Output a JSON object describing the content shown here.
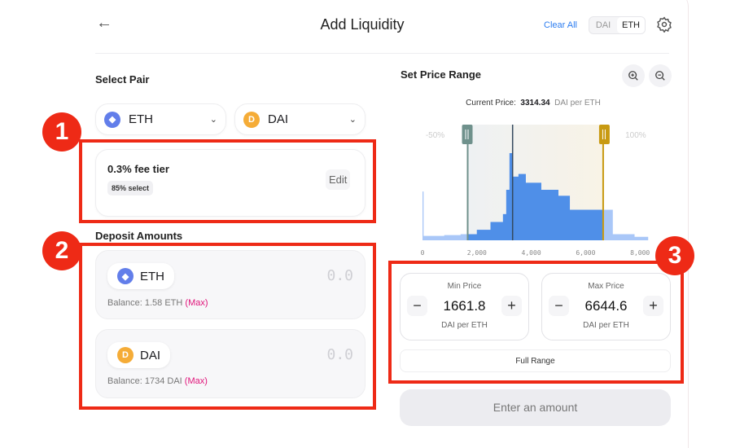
{
  "header": {
    "title": "Add Liquidity",
    "clear_all": "Clear All",
    "toggle": [
      "DAI",
      "ETH"
    ],
    "toggle_selected": "ETH",
    "back_icon": "arrow-left-icon",
    "settings_icon": "gear-icon"
  },
  "select_pair": {
    "label": "Select Pair",
    "token_a": "ETH",
    "token_b": "DAI"
  },
  "fee": {
    "title": "0.3% fee tier",
    "badge": "85% select",
    "edit": "Edit"
  },
  "deposit": {
    "label": "Deposit Amounts",
    "items": [
      {
        "token": "ETH",
        "amount": "0.0",
        "balance": "Balance: 1.58 ETH",
        "max": "(Max)"
      },
      {
        "token": "DAI",
        "amount": "0.0",
        "balance": "Balance: 1734 DAI",
        "max": "(Max)"
      }
    ]
  },
  "price_range": {
    "label": "Set Price Range",
    "current_label": "Current Price:",
    "current_value": "3314.34",
    "current_unit": "DAI per ETH",
    "min_pct": "-50%",
    "max_pct": "100%"
  },
  "chart_data": {
    "type": "area",
    "x_ticks": [
      "0",
      "2,000",
      "4,000",
      "6,000",
      "8,000"
    ],
    "xlim": [
      0,
      8300
    ],
    "liquidity_steps": [
      [
        0,
        56
      ],
      [
        40,
        5
      ],
      [
        800,
        6
      ],
      [
        1400,
        7
      ],
      [
        1620,
        7
      ],
      [
        2000,
        12
      ],
      [
        2500,
        21
      ],
      [
        2960,
        30
      ],
      [
        3080,
        58
      ],
      [
        3200,
        100
      ],
      [
        3300,
        73
      ],
      [
        3530,
        76
      ],
      [
        3800,
        66
      ],
      [
        4370,
        58
      ],
      [
        5000,
        51
      ],
      [
        5420,
        35
      ],
      [
        7000,
        7
      ],
      [
        7800,
        4
      ],
      [
        8300,
        3
      ]
    ],
    "range": {
      "min": 1661.8,
      "max": 6644.6,
      "current": 3314.34
    },
    "colors": {
      "in_range": "#4f8fe8",
      "out_range": "#a9c7f8",
      "min_handle": "#6f918c",
      "max_handle": "#c89a12",
      "current": "#34495e"
    }
  },
  "min_price": {
    "label": "Min Price",
    "value": "1661.8",
    "unit": "DAI per ETH"
  },
  "max_price": {
    "label": "Max Price",
    "value": "6644.6",
    "unit": "DAI per ETH"
  },
  "full_range": "Full Range",
  "submit": "Enter an amount",
  "annotations": [
    "1",
    "2",
    "3"
  ]
}
